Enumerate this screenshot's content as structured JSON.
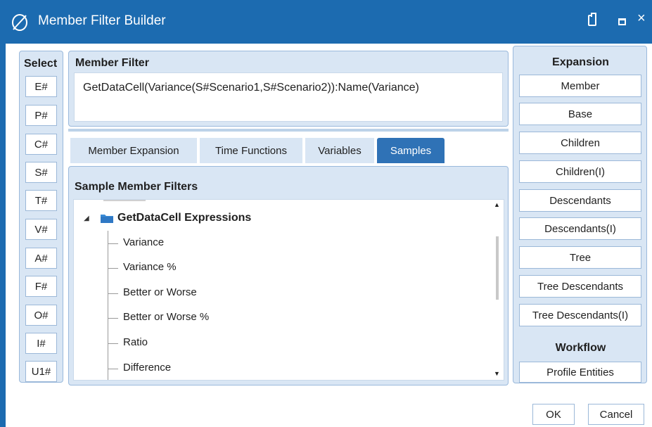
{
  "window": {
    "title": "Member Filter Builder",
    "accent_color": "#1c6bb0",
    "logo_icon": "onestream-logo-icon",
    "controls": [
      "clipboard-icon",
      "maximize-icon",
      "close-icon"
    ],
    "close_glyph": "×"
  },
  "select": {
    "title": "Select",
    "items": [
      "E#",
      "P#",
      "C#",
      "S#",
      "T#",
      "V#",
      "A#",
      "F#",
      "O#",
      "I#",
      "U1#"
    ]
  },
  "member_filter": {
    "title": "Member Filter",
    "value": "GetDataCell(Variance(S#Scenario1,S#Scenario2)):Name(Variance)"
  },
  "tabs": {
    "items": [
      "Member Expansion",
      "Time Functions",
      "Variables",
      "Samples"
    ],
    "active": "Samples",
    "active_color": "#2f72b6"
  },
  "samples": {
    "title": "Sample Member Filters",
    "group": {
      "label": "GetDataCell Expressions",
      "expanded": true,
      "icon": "folder-icon",
      "children": [
        "Variance",
        "Variance %",
        "Better or Worse",
        "Better or Worse %",
        "Ratio",
        "Difference"
      ]
    }
  },
  "expansion": {
    "title": "Expansion",
    "items": [
      "Member",
      "Base",
      "Children",
      "Children(I)",
      "Descendants",
      "Descendants(I)",
      "Tree",
      "Tree Descendants",
      "Tree Descendants(I)"
    ],
    "workflow_title": "Workflow",
    "workflow_items": [
      "Profile Entities"
    ]
  },
  "footer": {
    "ok_label": "OK",
    "cancel_label": "Cancel"
  }
}
